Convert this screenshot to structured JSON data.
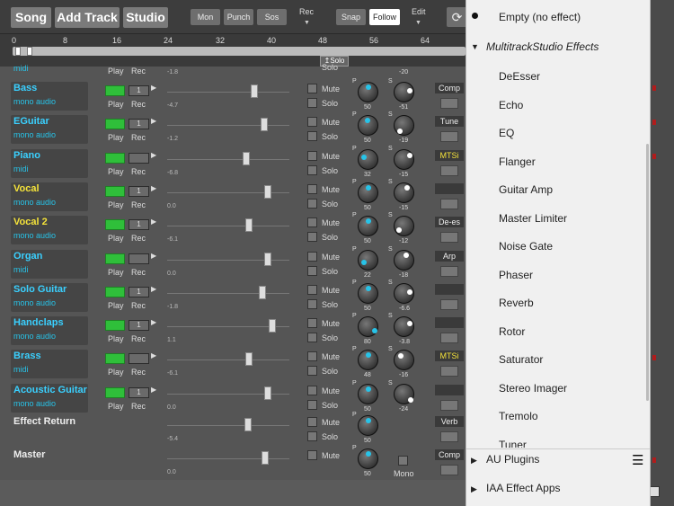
{
  "toolbar": {
    "song": "Song",
    "add_track": "Add Track",
    "studio": "Studio",
    "mon": "Mon",
    "punch": "Punch",
    "sos": "Sos",
    "rec": "Rec",
    "snap": "Snap",
    "follow": "Follow",
    "edit": "Edit"
  },
  "ruler": {
    "ticks": [
      "0",
      "8",
      "16",
      "24",
      "32",
      "40",
      "48",
      "56",
      "64"
    ],
    "solo_tag": "Solo"
  },
  "partial_top": {
    "type": "midi",
    "play": "Play",
    "rec": "Rec",
    "fader_value": "-1.8",
    "solo": "Solo",
    "s_value": "-20"
  },
  "tracks": [
    {
      "name": "Bass",
      "type": "mono audio",
      "rec_num": "1",
      "fader_value": "-4.7",
      "p": "50",
      "s": "-51",
      "plugin": "Comp",
      "name_color": "#3ad0ff"
    },
    {
      "name": "EGuitar",
      "type": "mono audio",
      "rec_num": "1",
      "fader_value": "-1.2",
      "p": "50",
      "s": "-19",
      "plugin": "Tune",
      "name_color": "#3ad0ff"
    },
    {
      "name": "Piano",
      "type": "midi",
      "rec_num": "",
      "fader_value": "-6.8",
      "p": "32",
      "s": "-15",
      "plugin": "MTSi",
      "name_color": "#3ad0ff"
    },
    {
      "name": "Vocal",
      "type": "mono audio",
      "rec_num": "1",
      "fader_value": "0.0",
      "p": "50",
      "s": "-15",
      "plugin": "",
      "name_color": "#f4e23a"
    },
    {
      "name": "Vocal 2",
      "type": "mono audio",
      "rec_num": "1",
      "fader_value": "-6.1",
      "p": "50",
      "s": "-12",
      "plugin": "De-es",
      "name_color": "#f4e23a"
    },
    {
      "name": "Organ",
      "type": "midi",
      "rec_num": "",
      "fader_value": "0.0",
      "p": "22",
      "s": "-18",
      "plugin": "Arp",
      "name_color": "#3ad0ff"
    },
    {
      "name": "Solo Guitar",
      "type": "mono audio",
      "rec_num": "1",
      "fader_value": "-1.8",
      "p": "50",
      "s": "-6.6",
      "plugin": "",
      "name_color": "#3ad0ff"
    },
    {
      "name": "Handclaps",
      "type": "mono audio",
      "rec_num": "1",
      "fader_value": "1.1",
      "p": "80",
      "s": "-3.8",
      "plugin": "",
      "name_color": "#3ad0ff"
    },
    {
      "name": "Brass",
      "type": "midi",
      "rec_num": "",
      "fader_value": "-6.1",
      "p": "48",
      "s": "-16",
      "plugin": "MTSi",
      "name_color": "#3ad0ff"
    },
    {
      "name": "Acoustic Guitar",
      "type": "mono audio",
      "rec_num": "1",
      "fader_value": "0.0",
      "p": "50",
      "s": "-24",
      "plugin": "",
      "name_color": "#3ad0ff"
    }
  ],
  "effect_return": {
    "name": "Effect Return",
    "fader_value": "-5.4",
    "p": "50",
    "plugin": "Verb"
  },
  "master": {
    "name": "Master",
    "fader_value": "0.0",
    "p": "50",
    "mono": "Mono",
    "plugin": "Comp"
  },
  "labels": {
    "play": "Play",
    "rec": "Rec",
    "mute": "Mute",
    "solo": "Solo",
    "p": "P",
    "s": "S"
  },
  "menu": {
    "empty": "Empty (no effect)",
    "section_multitrack": "MultitrackStudio Effects",
    "effects": [
      "DeEsser",
      "Echo",
      "EQ",
      "Flanger",
      "Guitar Amp",
      "Master Limiter",
      "Noise Gate",
      "Phaser",
      "Reverb",
      "Rotor",
      "Saturator",
      "Stereo Imager",
      "Tremolo",
      "Tuner"
    ],
    "au_plugins": "AU Plugins",
    "iaa_apps": "IAA Effect Apps"
  },
  "colors": {
    "accent_cyan": "#27c3e8",
    "green": "#2fbf3a",
    "yellow": "#f4e23a"
  }
}
